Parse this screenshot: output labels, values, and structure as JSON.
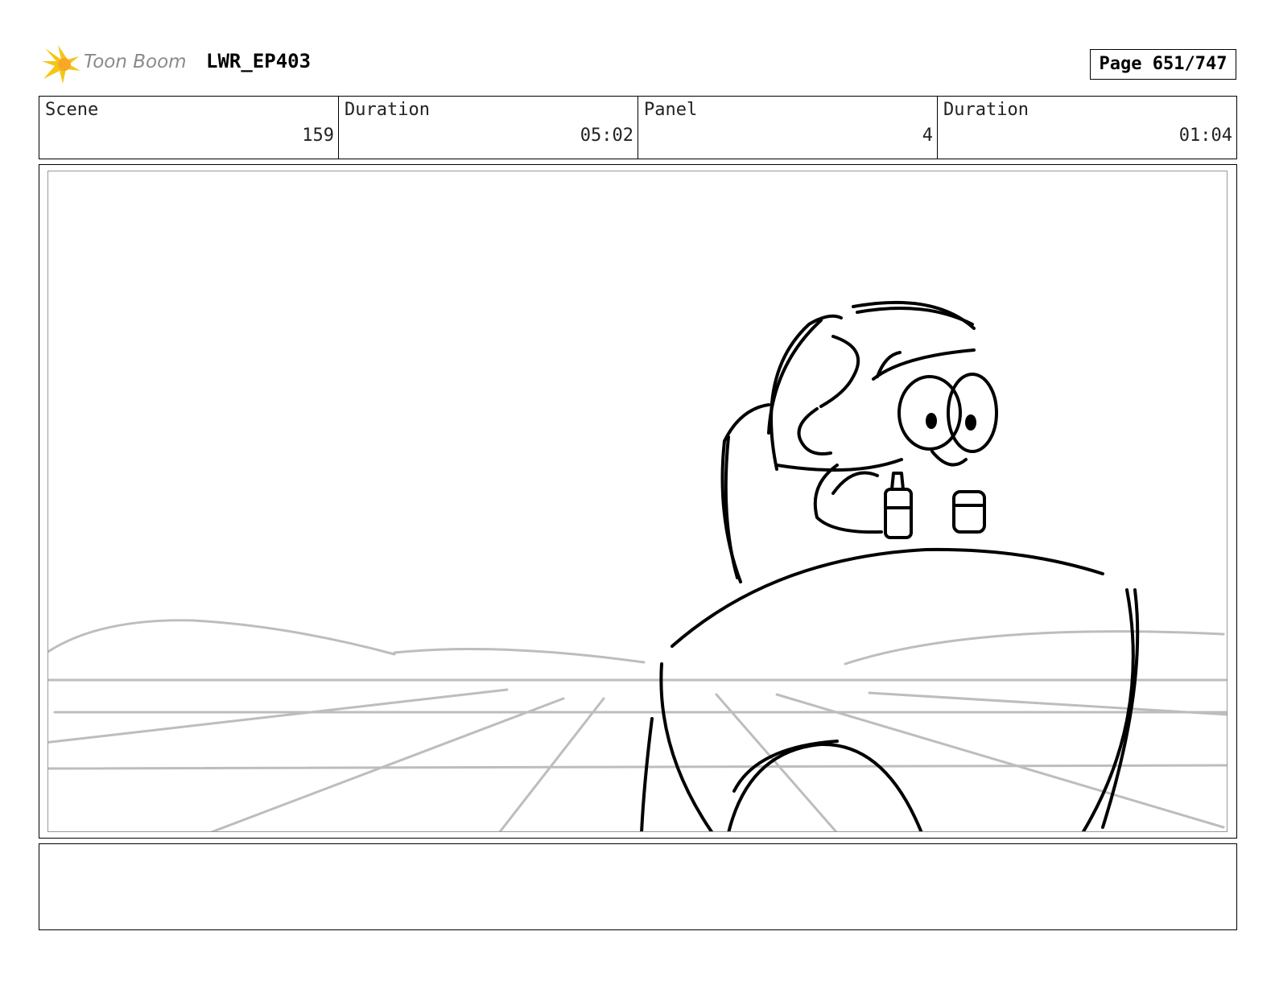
{
  "header": {
    "brand": "Toon Boom",
    "project": "LWR_EP403",
    "page_label": "Page 651/747",
    "brand_color": "#f5c518"
  },
  "info": {
    "scene_label": "Scene",
    "scene_value": "159",
    "scene_duration_label": "Duration",
    "scene_duration_value": "05:02",
    "panel_label": "Panel",
    "panel_value": "4",
    "panel_duration_label": "Duration",
    "panel_duration_value": "01:04"
  },
  "notes": {
    "text": ""
  }
}
